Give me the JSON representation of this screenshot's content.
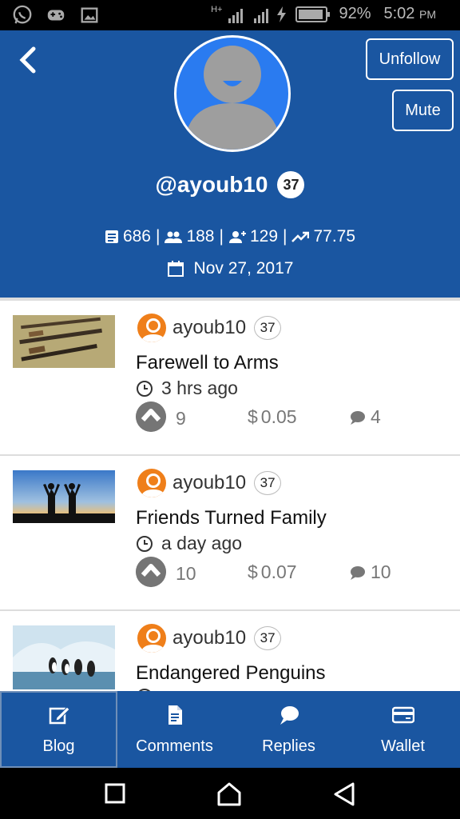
{
  "status_bar": {
    "battery": "92%",
    "time": "5:02",
    "ampm": "PM",
    "network": "H+"
  },
  "profile": {
    "username": "@ayoub10",
    "reputation": "37",
    "posts": "686",
    "followers": "188",
    "following": "129",
    "power": "77.75",
    "joined": "Nov 27, 2017",
    "unfollow_label": "Unfollow",
    "mute_label": "Mute",
    "accent": "#1a56a1"
  },
  "posts": [
    {
      "author": "ayoub10",
      "reputation": "37",
      "title": "Farewell to Arms",
      "time": "3 hrs ago",
      "votes": "9",
      "payout": "0.05",
      "currency": "$",
      "comments": "4"
    },
    {
      "author": "ayoub10",
      "reputation": "37",
      "title": "Friends Turned Family",
      "time": "a day ago",
      "votes": "10",
      "payout": "0.07",
      "currency": "$",
      "comments": "10"
    },
    {
      "author": "ayoub10",
      "reputation": "37",
      "title": "Endangered Penguins",
      "time": "",
      "votes": "",
      "payout": "",
      "currency": "",
      "comments": ""
    }
  ],
  "tabs": [
    {
      "label": "Blog",
      "icon": "edit-icon"
    },
    {
      "label": "Comments",
      "icon": "document-icon"
    },
    {
      "label": "Replies",
      "icon": "chat-icon"
    },
    {
      "label": "Wallet",
      "icon": "wallet-icon"
    }
  ]
}
